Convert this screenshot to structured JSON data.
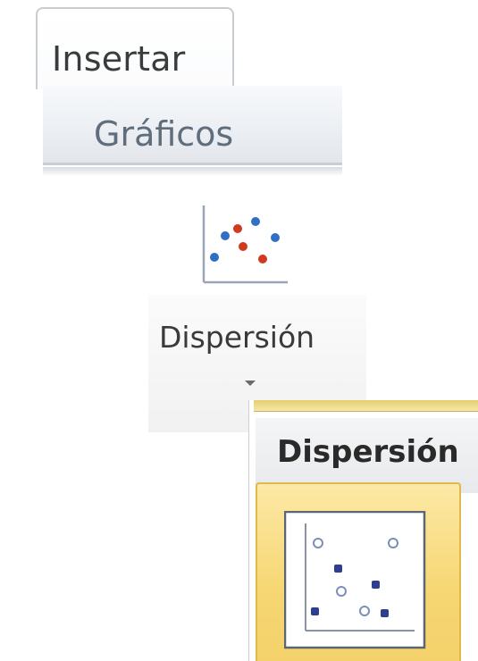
{
  "ribbon": {
    "tab_label": "Insertar",
    "group_label": "Gráficos"
  },
  "chart_button": {
    "label": "Dispersión",
    "icon": "scatter-chart-icon",
    "dropdown_icon": "dropdown-arrow-icon"
  },
  "gallery": {
    "header": "Dispersión",
    "options": [
      {
        "icon": "scatter-markers-only-icon",
        "selected": true
      }
    ]
  },
  "colors": {
    "accent_tile": "#f6d773",
    "tile_border": "#e0b94a",
    "group_label": "#5f6d7c",
    "scatter_blue": "#2f6fc4",
    "scatter_red": "#d13a1e",
    "marker_navy": "#2f3f8f"
  }
}
